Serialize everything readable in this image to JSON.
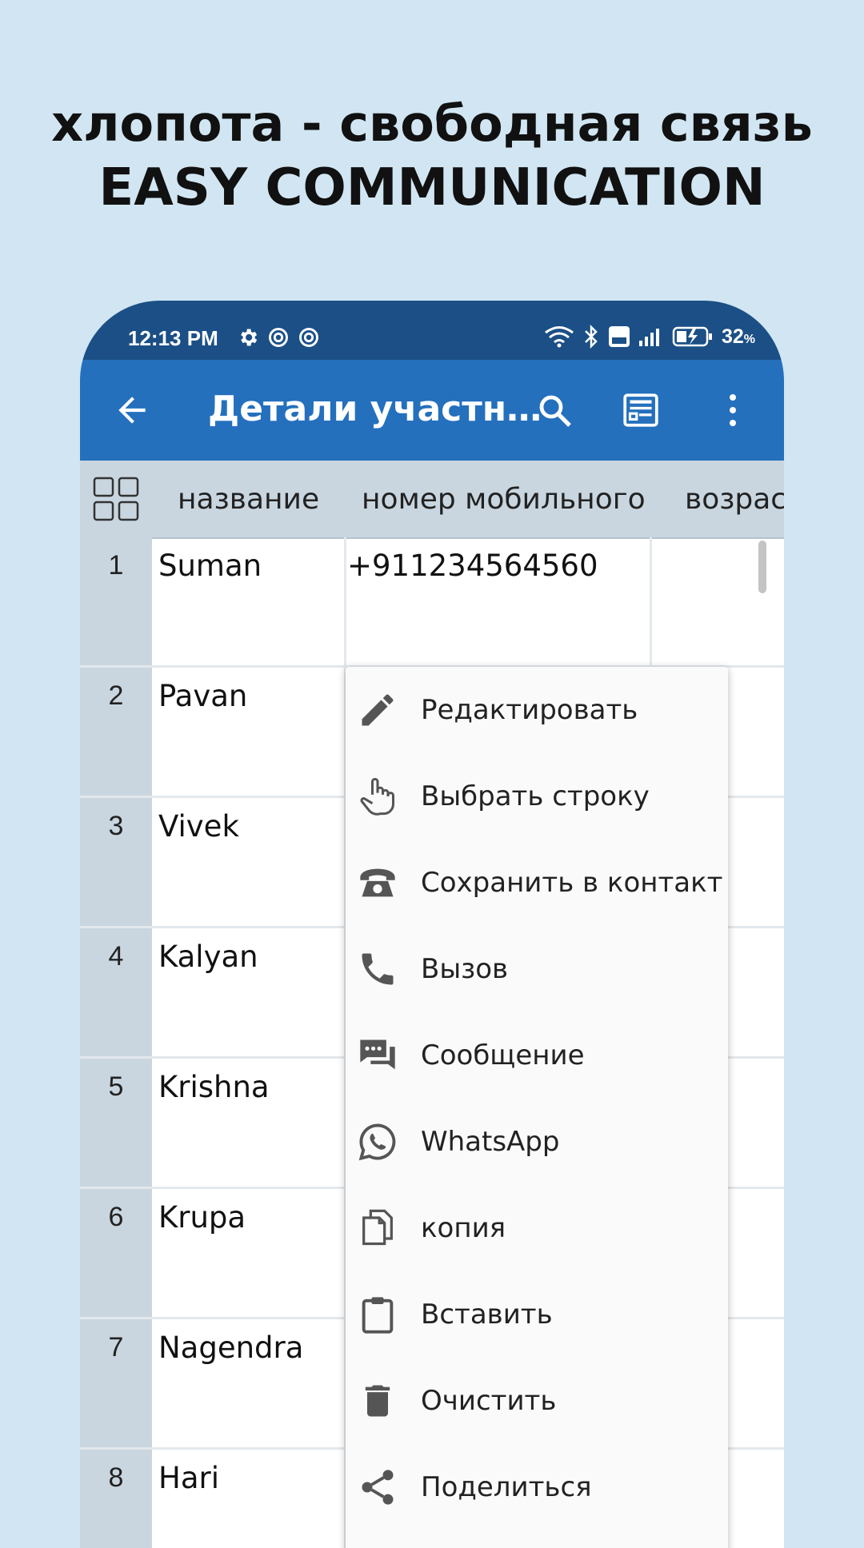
{
  "headline": {
    "line1": "хлопота - свободная связь",
    "line2": "EASY COMMUNICATION"
  },
  "status_bar": {
    "time": "12:13 PM",
    "battery": "32",
    "battery_unit": "%"
  },
  "app_bar": {
    "title": "Детали участн…",
    "icons": [
      "back-arrow-icon",
      "search-icon",
      "detail-view-icon",
      "more-vert-icon"
    ]
  },
  "columns": [
    "название",
    "номер мобильного",
    "возрас"
  ],
  "rows": [
    {
      "num": "1",
      "name": "Suman",
      "phone": "+911234564560"
    },
    {
      "num": "2",
      "name": "Pavan",
      "phone": ""
    },
    {
      "num": "3",
      "name": "Vivek",
      "phone": ""
    },
    {
      "num": "4",
      "name": "Kalyan",
      "phone": ""
    },
    {
      "num": "5",
      "name": "Krishna",
      "phone": ""
    },
    {
      "num": "6",
      "name": "Krupa",
      "phone": ""
    },
    {
      "num": "7",
      "name": "Nagendra",
      "phone": ""
    },
    {
      "num": "8",
      "name": "Hari",
      "phone": ""
    }
  ],
  "menu": [
    {
      "label": "Редактировать",
      "icon": "pencil-icon"
    },
    {
      "label": "Выбрать строку",
      "icon": "hand-pointer-icon"
    },
    {
      "label": "Сохранить в контакт",
      "icon": "telephone-icon"
    },
    {
      "label": "Вызов",
      "icon": "phone-call-icon"
    },
    {
      "label": "Сообщение",
      "icon": "chat-icon"
    },
    {
      "label": "WhatsApp",
      "icon": "whatsapp-icon"
    },
    {
      "label": "копия",
      "icon": "copy-icon"
    },
    {
      "label": "Вставить",
      "icon": "clipboard-icon"
    },
    {
      "label": "Очистить",
      "icon": "trash-icon"
    },
    {
      "label": "Поделиться",
      "icon": "share-icon"
    }
  ]
}
